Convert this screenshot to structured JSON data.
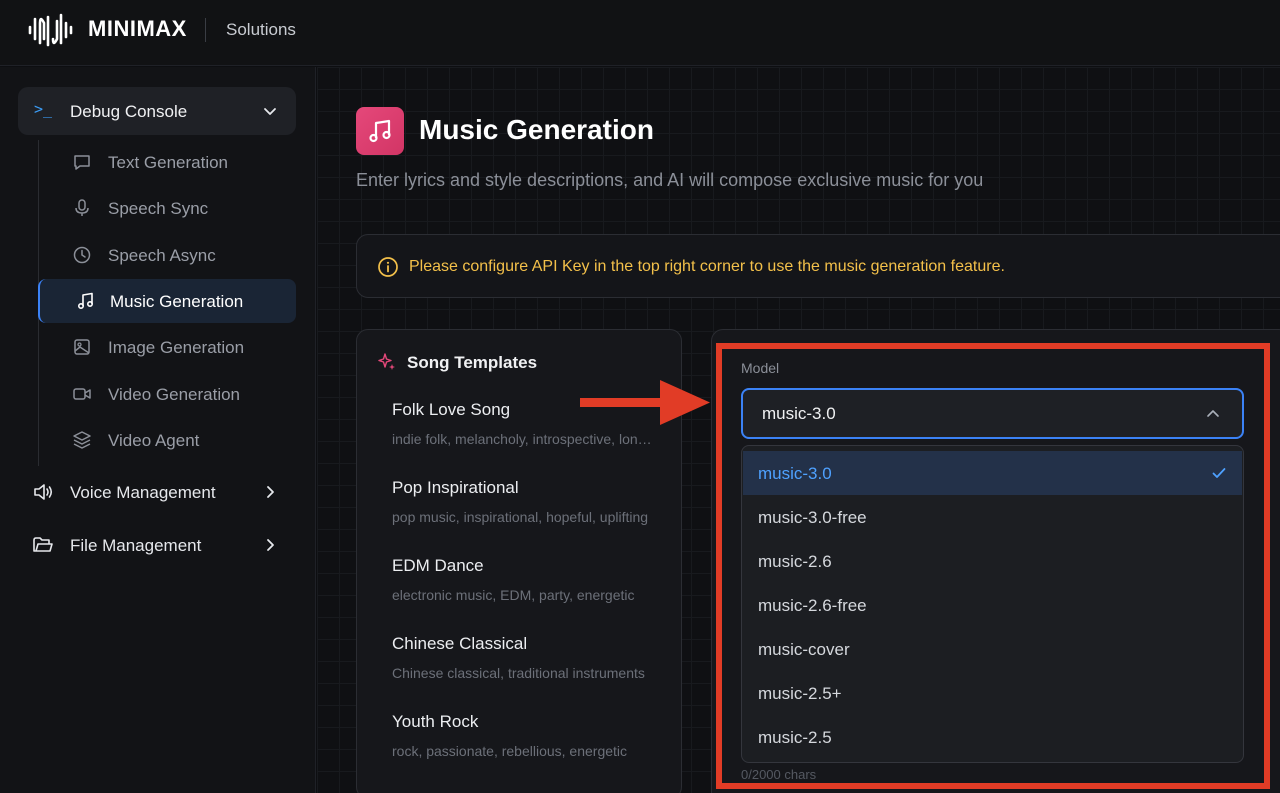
{
  "header": {
    "brand": "MINIMAX",
    "section": "Solutions"
  },
  "sidebar": {
    "group": {
      "label": "Debug Console",
      "icon": "terminal-icon"
    },
    "items": [
      {
        "label": "Text Generation",
        "icon": "message-square-icon"
      },
      {
        "label": "Speech Sync",
        "icon": "microphone-icon"
      },
      {
        "label": "Speech Async",
        "icon": "clock-icon"
      },
      {
        "label": "Music Generation",
        "icon": "music-note-icon",
        "active": true
      },
      {
        "label": "Image Generation",
        "icon": "image-icon"
      },
      {
        "label": "Video Generation",
        "icon": "video-camera-icon"
      },
      {
        "label": "Video Agent",
        "icon": "layers-icon"
      }
    ],
    "sections": [
      {
        "label": "Voice Management",
        "icon": "speaker-icon"
      },
      {
        "label": "File Management",
        "icon": "folder-icon"
      }
    ]
  },
  "page": {
    "title": "Music Generation",
    "subtitle": "Enter lyrics and style descriptions, and AI will compose exclusive music for you",
    "alert": "Please configure API Key in the top right corner to use the music generation feature."
  },
  "templates": {
    "title": "Song Templates",
    "items": [
      {
        "name": "Folk Love Song",
        "desc": "indie folk, melancholy, introspective, longing"
      },
      {
        "name": "Pop Inspirational",
        "desc": "pop music, inspirational, hopeful, uplifting"
      },
      {
        "name": "EDM Dance",
        "desc": "electronic music, EDM, party, energetic"
      },
      {
        "name": "Chinese Classical",
        "desc": "Chinese classical, traditional instruments"
      },
      {
        "name": "Youth Rock",
        "desc": "rock, passionate, rebellious, energetic"
      }
    ]
  },
  "model": {
    "label": "Model",
    "selected": "music-3.0",
    "options": [
      "music-3.0",
      "music-3.0-free",
      "music-2.6",
      "music-2.6-free",
      "music-cover",
      "music-2.5+",
      "music-2.5"
    ],
    "char_count": "0/2000 chars"
  },
  "colors": {
    "accent": "#3b82f6",
    "warning": "#f3c04a",
    "annotation": "#e13c26",
    "music_icon_bg": "#e5487a"
  }
}
